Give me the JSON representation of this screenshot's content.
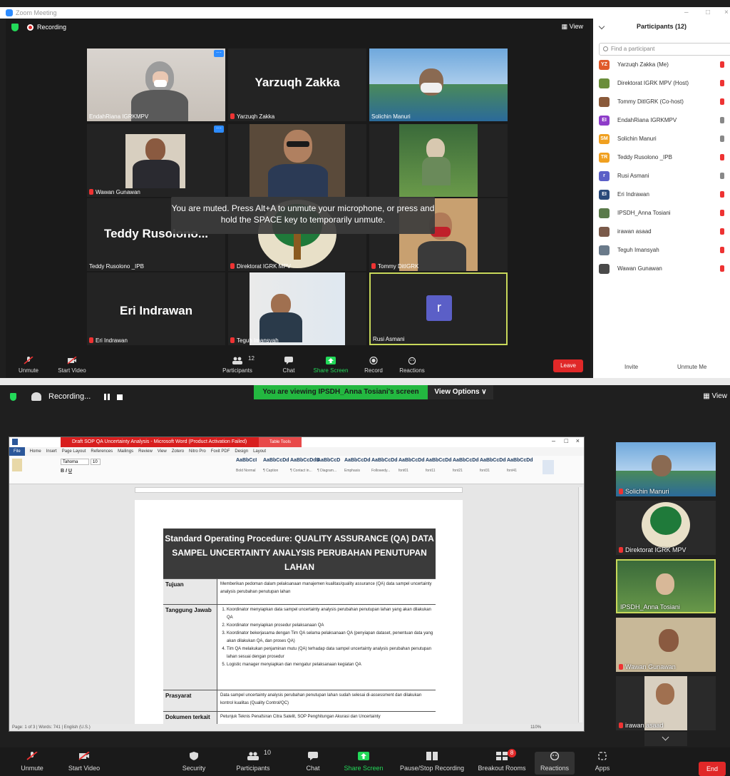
{
  "top": {
    "window_title": "Zoom Meeting",
    "recording_label": "Recording",
    "view_label": "View",
    "tiles": [
      {
        "name": "EndahRiana IGRKMPV",
        "big": ""
      },
      {
        "name": "Yarzuqh Zakka",
        "big": "Yarzuqh Zakka"
      },
      {
        "name": "Solichin Manuri",
        "big": ""
      },
      {
        "name": "Wawan Gunawan",
        "big": ""
      },
      {
        "name": "",
        "big": ""
      },
      {
        "name": "",
        "big": ""
      },
      {
        "name": "Teddy Rusolono _IPB",
        "big": "Teddy  Rusolono..."
      },
      {
        "name": "Direktorat IGRK MPV",
        "big": ""
      },
      {
        "name": "Tommy DitIGRK",
        "big": ""
      },
      {
        "name": "Eri Indrawan",
        "big": "Eri Indrawan"
      },
      {
        "name": "Teguh Imansyah",
        "big": ""
      },
      {
        "name": "Rusi Asmani",
        "big": "r"
      }
    ],
    "muted_toast": "You are muted. Press Alt+A to unmute your microphone, or press and hold the SPACE key to temporarily unmute.",
    "toolbar": {
      "unmute": "Unmute",
      "start_video": "Start Video",
      "participants": "Participants",
      "participants_count": "12",
      "chat": "Chat",
      "share_screen": "Share Screen",
      "record": "Record",
      "reactions": "Reactions",
      "leave": "Leave"
    },
    "participants_panel": {
      "title": "Participants (12)",
      "search_placeholder": "Find a participant",
      "invite": "Invite",
      "unmute_me": "Unmute Me",
      "list": [
        {
          "initials": "YZ",
          "name": "Yarzuqh Zakka (Me)",
          "color": "#e05a2b"
        },
        {
          "initials": "",
          "name": "Direktorat IGRK MPV (Host)",
          "color": "#6b8e3a"
        },
        {
          "initials": "",
          "name": "Tommy DitIGRK (Co-host)",
          "color": "#8a5a3a"
        },
        {
          "initials": "EI",
          "name": "EndahRiana IGRKMPV",
          "color": "#8e3cc9"
        },
        {
          "initials": "SM",
          "name": "Solichin Manuri",
          "color": "#f0a020"
        },
        {
          "initials": "TR",
          "name": "Teddy Rusolono _IPB",
          "color": "#f0a020"
        },
        {
          "initials": "r",
          "name": "Rusi Asmani",
          "color": "#5b5fc7"
        },
        {
          "initials": "EI",
          "name": "Eri Indrawan",
          "color": "#2a4a7a"
        },
        {
          "initials": "",
          "name": "IPSDH_Anna Tosiani",
          "color": "#5a7a4a"
        },
        {
          "initials": "",
          "name": "irawan asaad",
          "color": "#7a5a4a"
        },
        {
          "initials": "",
          "name": "Teguh Imansyah",
          "color": "#6a7a8a"
        },
        {
          "initials": "",
          "name": "Wawan Gunawan",
          "color": "#4a4a4a"
        }
      ]
    }
  },
  "bottom": {
    "recording_label": "Recording...",
    "viewing_text": "You are viewing IPSDH_Anna Tosiani's screen",
    "view_options": "View Options ∨",
    "view_label": "View",
    "word": {
      "title": "Draft SOP QA Uncertainty Analysis - Microsoft Word (Product Activation Failed)",
      "table_tools": "Table Tools",
      "tabs": [
        "File",
        "Home",
        "Insert",
        "Page Layout",
        "References",
        "Mailings",
        "Review",
        "View",
        "Zotero",
        "Nitro Pro",
        "Foxit PDF",
        "Design",
        "Layout"
      ],
      "font": "Tahoma",
      "font_size": "10",
      "styles": [
        {
          "sample": "AaBbCcI",
          "name": "Bold Normal"
        },
        {
          "sample": "AaBbCcDd",
          "name": "¶ Caption"
        },
        {
          "sample": "AaBbCcDdE",
          "name": "¶ Contact in..."
        },
        {
          "sample": "AaBbCcD",
          "name": "¶ Diagram..."
        },
        {
          "sample": "AaBbCcDd",
          "name": "Emphasis"
        },
        {
          "sample": "AaBbCcDd",
          "name": "Followedy..."
        },
        {
          "sample": "AaBbCcDd",
          "name": "font01"
        },
        {
          "sample": "AaBbCcDd",
          "name": "font11"
        },
        {
          "sample": "AaBbCcDd",
          "name": "font21"
        },
        {
          "sample": "AaBbCcDd",
          "name": "font31"
        },
        {
          "sample": "AaBbCcDd",
          "name": "font41"
        }
      ],
      "status": "Page: 1 of 3  |  Words: 741  |  English (U.S.)",
      "zoom": "110%",
      "sop_title": "Standard Operating Procedure: QUALITY ASSURANCE (QA) DATA SAMPEL UNCERTAINTY ANALYSIS PERUBAHAN PENUTUPAN LAHAN",
      "rows": [
        {
          "label": "Tujuan",
          "text": "Memberikan pedoman dalam pelaksanaan manajemen kualitas/quality assurance (QA) data sampel uncertainty analysis perubahan penutupan lahan"
        },
        {
          "label": "Tanggung Jawab",
          "items": [
            "Koordinator menyiapkan data sampel uncertainty analysis perubahan penutupan lahan yang akan dilakukan QA",
            "Koordinator menyiapkan prosedur pelaksanaan QA",
            "Koordinator bekerjasama dengan Tim QA selama pelaksanaan QA (penyiapan dataset, penentuan data yang akan dilakukan QA, dan proses QA)",
            "Tim QA melakukan penjaminan mutu (QA) terhadap data sampel uncertainty analysis perubahan penutupan lahan sesuai dengan prosedur",
            "Logistic manager menyiapkan dan mengatur pelaksanaan kegiatan QA"
          ]
        },
        {
          "label": "Prasyarat",
          "text": "Data sampel uncertainty analysis perubahan penutupan lahan sudah selesai di-assessment dan dilakukan kontrol kualitas (Quality Control/QC)"
        },
        {
          "label": "Dokumen terkait",
          "text": "Petunjuk Teknis Penafsiran Citra Satelit, SOP Penghitungan Akurasi dan Uncertainty"
        }
      ]
    },
    "side_tiles": [
      "Solichin Manuri",
      "Direktorat IGRK MPV",
      "IPSDH_Anna Tosiani",
      "Wawan Gunawan",
      "irawan asaad"
    ],
    "toolbar": {
      "unmute": "Unmute",
      "start_video": "Start Video",
      "security": "Security",
      "participants": "Participants",
      "participants_count": "10",
      "chat": "Chat",
      "share_screen": "Share Screen",
      "pause_stop": "Pause/Stop Recording",
      "breakout": "Breakout Rooms",
      "breakout_badge": "8",
      "reactions": "Reactions",
      "apps": "Apps",
      "end": "End"
    }
  }
}
